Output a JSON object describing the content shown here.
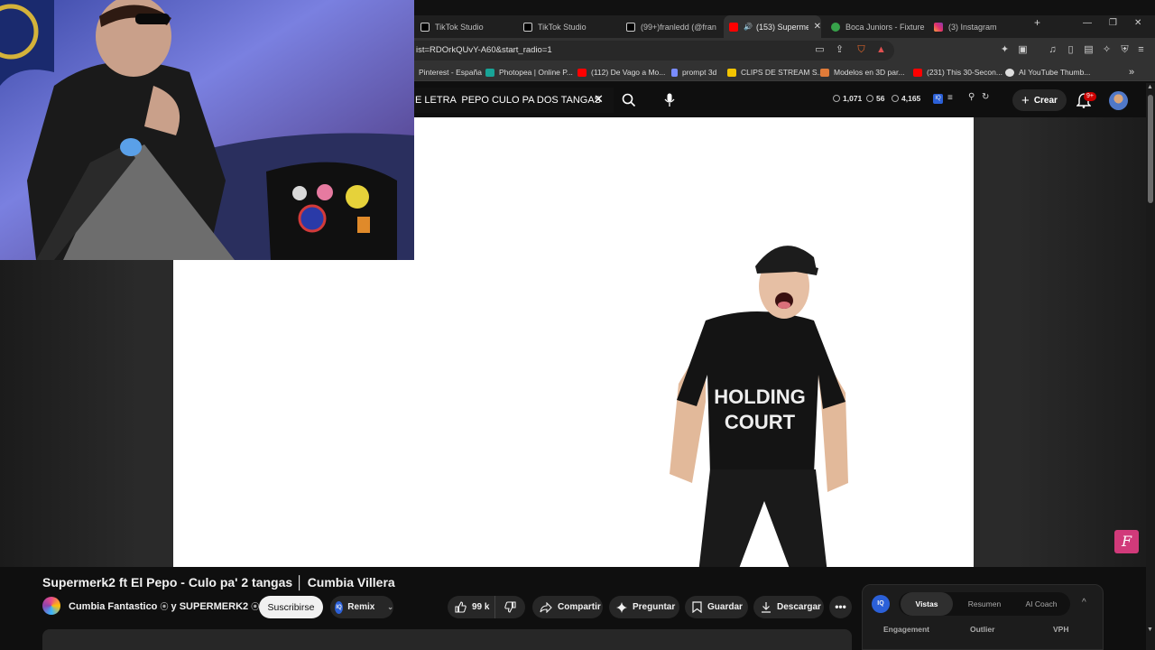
{
  "browser": {
    "tabs": [
      {
        "label": "TikTok Studio",
        "icon": "tiktok-icon",
        "active": false
      },
      {
        "label": "TikTok Studio",
        "icon": "tiktok-icon",
        "active": false
      },
      {
        "label": "(99+)franledd (@franle",
        "icon": "tiktok-icon",
        "active": false
      },
      {
        "label": "(153) Supermer",
        "icon": "youtube-icon",
        "active": true
      },
      {
        "label": "Boca Juniors - Fixture",
        "icon": "globe-icon",
        "active": false
      },
      {
        "label": "(3) Instagram",
        "icon": "instagram-icon",
        "active": false
      }
    ],
    "new_tab": "+",
    "url": "ist=RDOrkQUvY-A60&start_radio=1",
    "bookmarks": [
      {
        "label": "Pinterest - España",
        "color": "#e60023"
      },
      {
        "label": "Photopea | Online P...",
        "color": "#18a497"
      },
      {
        "label": "(112) De Vago a Mo...",
        "color": "#ff0000"
      },
      {
        "label": "prompt 3d",
        "color": "#7a8cff"
      },
      {
        "label": "CLIPS DE STREAM S...",
        "color": "#f2c400"
      },
      {
        "label": "Modelos en 3D par...",
        "color": "#e07b39"
      },
      {
        "label": "(231) This 30-Secon...",
        "color": "#ff0000"
      },
      {
        "label": "AI YouTube Thumb...",
        "color": "#dddddd"
      }
    ],
    "bookmarks_more": "»"
  },
  "youtube": {
    "search_query": "E LETRA  PEPO CULO PA DOS TANGAS",
    "clear_glyph": "✕",
    "stats": {
      "a": "1,071",
      "b": "56",
      "c": "4,165"
    },
    "create_label": "Crear",
    "notif_count": "9+"
  },
  "video": {
    "title": "Supermerk2 ft El Pepo - Culo pa' 2 tangas │ Cumbia Villera",
    "channel": "Cumbia Fantastico",
    "channel_join": "y SUPERMERK2",
    "subscribe_label": "Suscribirse",
    "remix_label": "Remix",
    "likes": "99 k",
    "share_label": "Compartir",
    "ask_label": "Preguntar",
    "save_label": "Guardar",
    "download_label": "Descargar",
    "more_label": "•••",
    "shirt_text": "HOLDING COURT",
    "ext_badge": "F"
  },
  "analytics": {
    "logo": "IQ",
    "tabs": [
      "Vistas",
      "Resumen",
      "AI Coach"
    ],
    "columns": [
      "Engagement",
      "Outlier",
      "VPH"
    ],
    "collapse": "^"
  },
  "colors": {
    "accent_red": "#cc0000",
    "brand_blue": "#2b60d8",
    "ext_pink": "#d13a7a"
  }
}
